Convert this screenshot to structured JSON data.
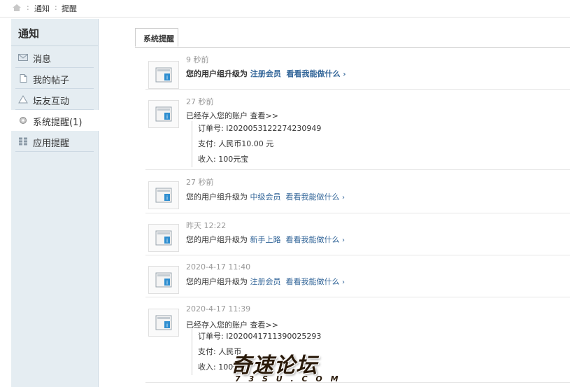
{
  "breadcrumb": {
    "sep": ":",
    "items": [
      "通知",
      "提醒"
    ]
  },
  "sidebar": {
    "title": "通知",
    "items": [
      {
        "label": "消息",
        "icon": "message-icon"
      },
      {
        "label": "我的帖子",
        "icon": "document-icon"
      },
      {
        "label": "坛友互动",
        "icon": "interaction-icon"
      },
      {
        "label": "系统提醒(1)",
        "icon": "gear-icon",
        "active": true
      },
      {
        "label": "应用提醒",
        "icon": "grid-icon"
      }
    ]
  },
  "tabs": [
    {
      "label": "系统提醒"
    }
  ],
  "notices": [
    {
      "time": "9 秒前",
      "prefix": "您的用户组升级为",
      "group": "注册会员",
      "link": "看看我能做什么",
      "bold": true
    },
    {
      "time": "27 秒前",
      "prefix": "已经存入您的账户",
      "link": "查看>>",
      "details": [
        "订单号: I202005312227423​0949",
        "支付: 人民币10.00 元",
        "收入: 100元宝"
      ]
    },
    {
      "time": "27 秒前",
      "prefix": "您的用户组升级为",
      "group": "中级会员",
      "link": "看看我能做什么"
    },
    {
      "time": "昨天 12:22",
      "prefix": "您的用户组升级为",
      "group": "新手上路",
      "link": "看看我能做什么"
    },
    {
      "time": "2020-4-17 11:40",
      "prefix": "您的用户组升级为",
      "group": "注册会员",
      "link": "看看我能做什么"
    },
    {
      "time": "2020-4-17 11:39",
      "prefix": "已经存入您的账户",
      "link": "查看>>",
      "details": [
        "订单号: I2020041711390025293",
        "支付: 人民币",
        "收入: 100元"
      ]
    }
  ],
  "watermark": {
    "title": "奇速论坛",
    "sub": "7 3 S U . C O M"
  },
  "colors": {
    "link": "#336699",
    "sidebar_bg": "#e5edf2",
    "divider": "#e6e6e6"
  }
}
